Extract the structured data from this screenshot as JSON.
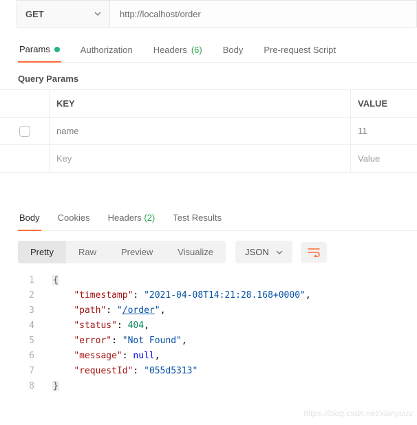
{
  "request": {
    "method": "GET",
    "url": "http://localhost/order"
  },
  "tabs": {
    "params": "Params",
    "authorization": "Authorization",
    "headers": "Headers",
    "headers_count": "(6)",
    "body": "Body",
    "prerequest": "Pre-request Script"
  },
  "query_params": {
    "title": "Query Params",
    "header_key": "KEY",
    "header_value": "VALUE",
    "rows": [
      {
        "key": "name",
        "value": "11"
      }
    ],
    "placeholder_key": "Key",
    "placeholder_value": "Value"
  },
  "response_tabs": {
    "body": "Body",
    "cookies": "Cookies",
    "headers": "Headers",
    "headers_count": "(2)",
    "test_results": "Test Results"
  },
  "view": {
    "pretty": "Pretty",
    "raw": "Raw",
    "preview": "Preview",
    "visualize": "Visualize",
    "format": "JSON"
  },
  "response_body": {
    "timestamp_key": "\"timestamp\"",
    "timestamp_val": "\"2021-04-08T14:21:28.168+0000\"",
    "path_key": "\"path\"",
    "path_val": "\"/order\"",
    "path_inner": "/order",
    "status_key": "\"status\"",
    "status_val": "404",
    "error_key": "\"error\"",
    "error_val": "\"Not Found\"",
    "message_key": "\"message\"",
    "message_val": "null",
    "requestId_key": "\"requestId\"",
    "requestId_val": "\"055d5313\""
  },
  "watermark": "https://blog.csdn.net/xianyuuu"
}
